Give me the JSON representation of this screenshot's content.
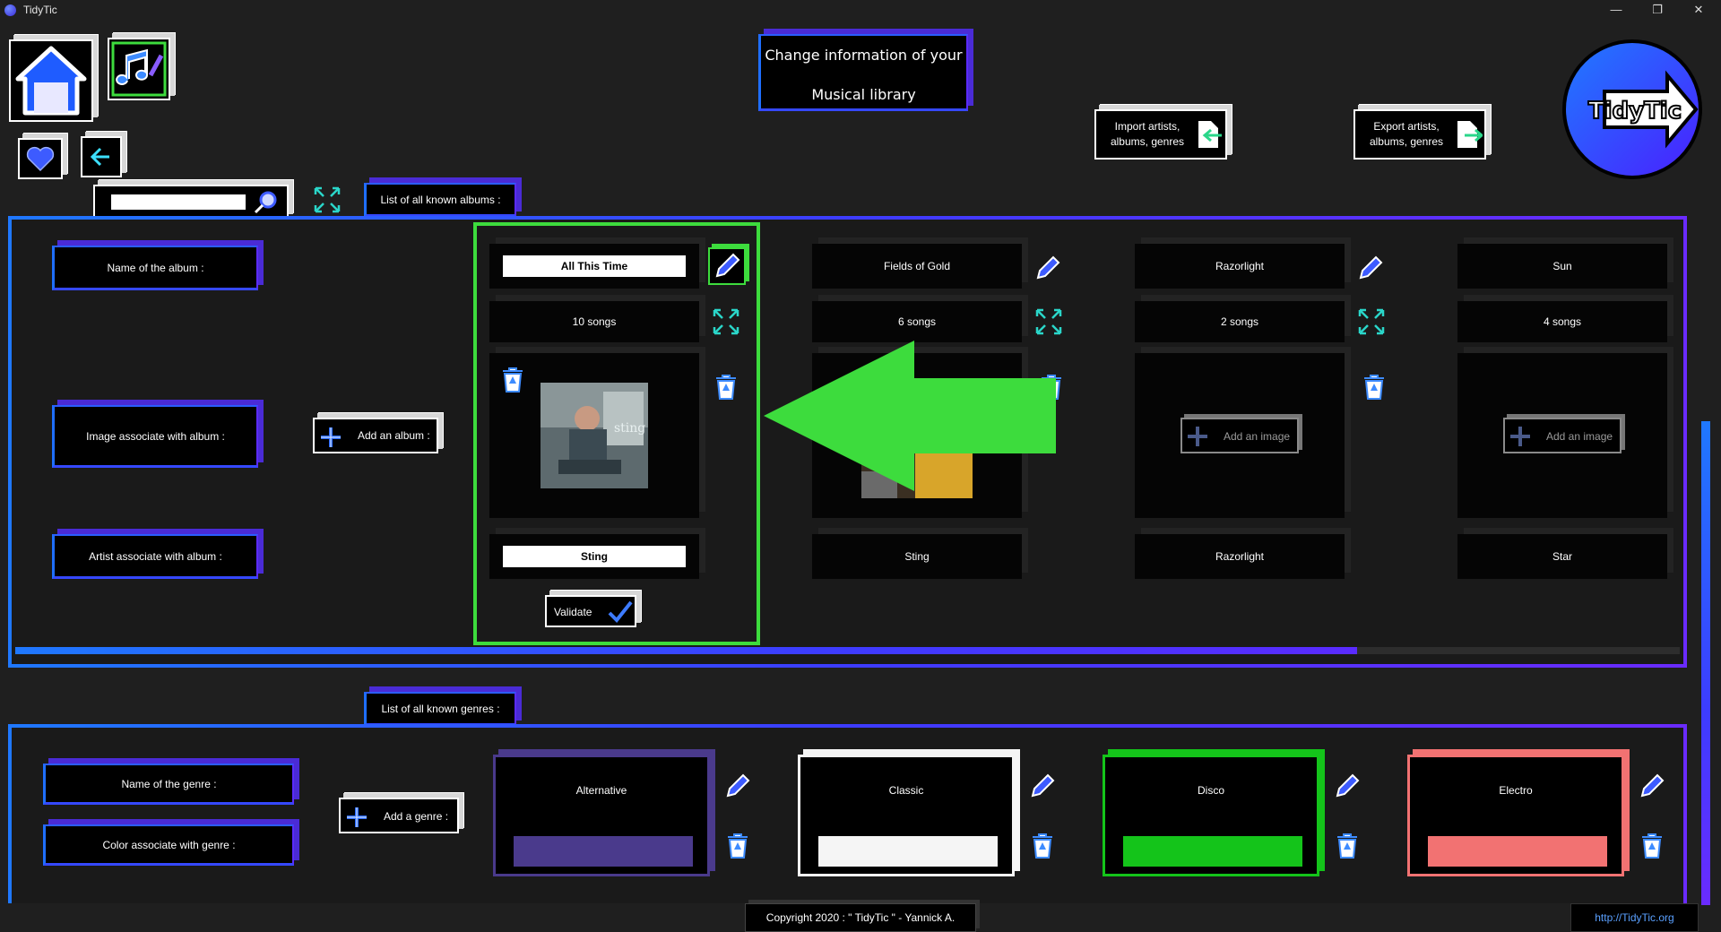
{
  "window": {
    "title": "TidyTic",
    "minimize": "—",
    "restore": "❐",
    "close": "✕"
  },
  "header": {
    "page_title_line1": "Change information of your",
    "page_title_line2": "Musical library",
    "import_label_line1": "Import artists,",
    "import_label_line2": "albums, genres",
    "export_label_line1": "Export artists,",
    "export_label_line2": "albums, genres",
    "logo_text": "TidyTic"
  },
  "nav": {
    "home_icon": "home-icon",
    "music_icon": "music-note-edit-icon",
    "favorites_icon": "heart-icon",
    "back_icon": "arrow-left-icon"
  },
  "search": {
    "value": "",
    "placeholder": ""
  },
  "albums_section": {
    "tab_label": "List of all known albums :",
    "row_labels": {
      "name": "Name of the album :",
      "image": "Image associate with album :",
      "artist": "Artist associate with album :"
    },
    "add_album_label": "Add an album :",
    "validate_label": "Validate",
    "albums": [
      {
        "name": "All This Time",
        "songs": "10 songs",
        "artist": "Sting",
        "has_image": true,
        "editing": true
      },
      {
        "name": "Fields of Gold",
        "songs": "6 songs",
        "artist": "Sting",
        "has_image": true,
        "editing": false
      },
      {
        "name": "Razorlight",
        "songs": "2 songs",
        "artist": "Razorlight",
        "has_image": false,
        "add_image_label": "Add an image",
        "editing": false
      },
      {
        "name": "Sun",
        "songs": "4 songs",
        "artist": "Star",
        "has_image": false,
        "add_image_label": "Add an image",
        "editing": false
      }
    ],
    "horizontal_scroll_fraction": 0.8
  },
  "genres_section": {
    "tab_label": "List of all known genres :",
    "row_labels": {
      "name": "Name of the genre :",
      "color": "Color associate with genre :"
    },
    "add_genre_label": "Add a genre :",
    "genres": [
      {
        "name": "Alternative",
        "color": "#4a3a8c"
      },
      {
        "name": "Classic",
        "color": "#f5f5f5"
      },
      {
        "name": "Disco",
        "color": "#14c41a"
      },
      {
        "name": "Electro",
        "color": "#f27272"
      }
    ]
  },
  "footer": {
    "copyright": "Copyright 2020 : \" TidyTic \" - Yannick A.",
    "url": "http://TidyTic.org"
  },
  "colors": {
    "accent_blue": "#1f78ff",
    "accent_purple": "#6a2bff",
    "highlight_green": "#3ddc3d",
    "arrow_green": "#3ddc3d"
  }
}
